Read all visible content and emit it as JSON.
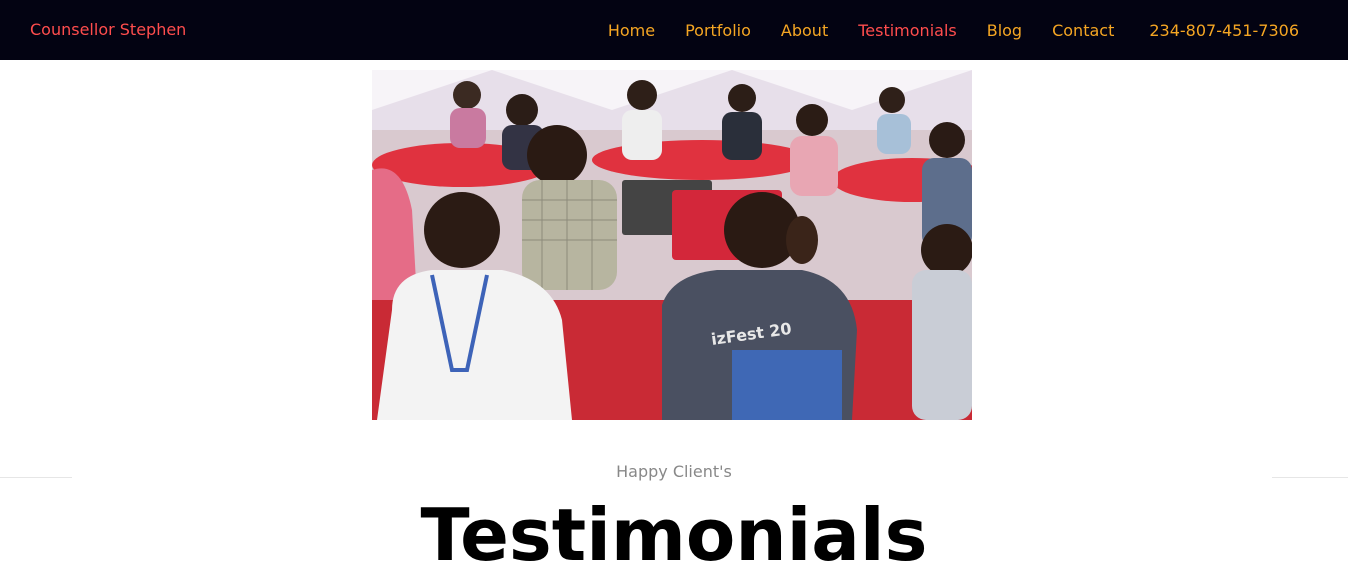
{
  "navbar": {
    "brand": "Counsellor Stephen",
    "links": [
      {
        "label": "Home",
        "active": false
      },
      {
        "label": "Portfolio",
        "active": false
      },
      {
        "label": "About",
        "active": false
      },
      {
        "label": "Testimonials",
        "active": true
      },
      {
        "label": "Blog",
        "active": false
      },
      {
        "label": "Contact",
        "active": false
      }
    ],
    "phone": "234-807-451-7306"
  },
  "hero": {
    "image": "conference-attendees-photo"
  },
  "section": {
    "subheading": "Happy Client's",
    "heading": "Testimonials"
  },
  "colors": {
    "navbar_bg": "#030312",
    "brand": "#ff4d4d",
    "link": "#f5a623",
    "active_link": "#ff4d4d",
    "subheading": "#888888",
    "heading": "#000000"
  }
}
